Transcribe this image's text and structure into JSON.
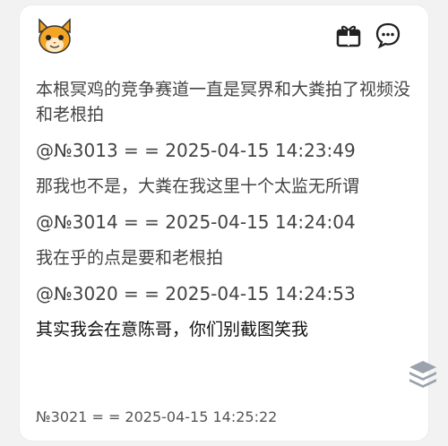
{
  "post": {
    "lines": [
      "本根冥鸡的竞争赛道一直是冥界和大粪拍了视频没和老根拍",
      "@№3013 = = 2025-04-15 14:23:49",
      "那我也不是，大粪在我这里十个太监无所谓",
      "@№3014 = = 2025-04-15 14:24:04",
      "我在乎的点是要和老根拍",
      "@№3020 = = 2025-04-15 14:24:53",
      "其实我会在意陈哥，你们别截图笑我"
    ],
    "footer": "№3021 = = 2025-04-15 14:25:22"
  },
  "icons": {
    "avatar": "cat-face-icon",
    "gift": "gift-icon",
    "comment": "comment-icon",
    "layers": "layers-icon"
  }
}
